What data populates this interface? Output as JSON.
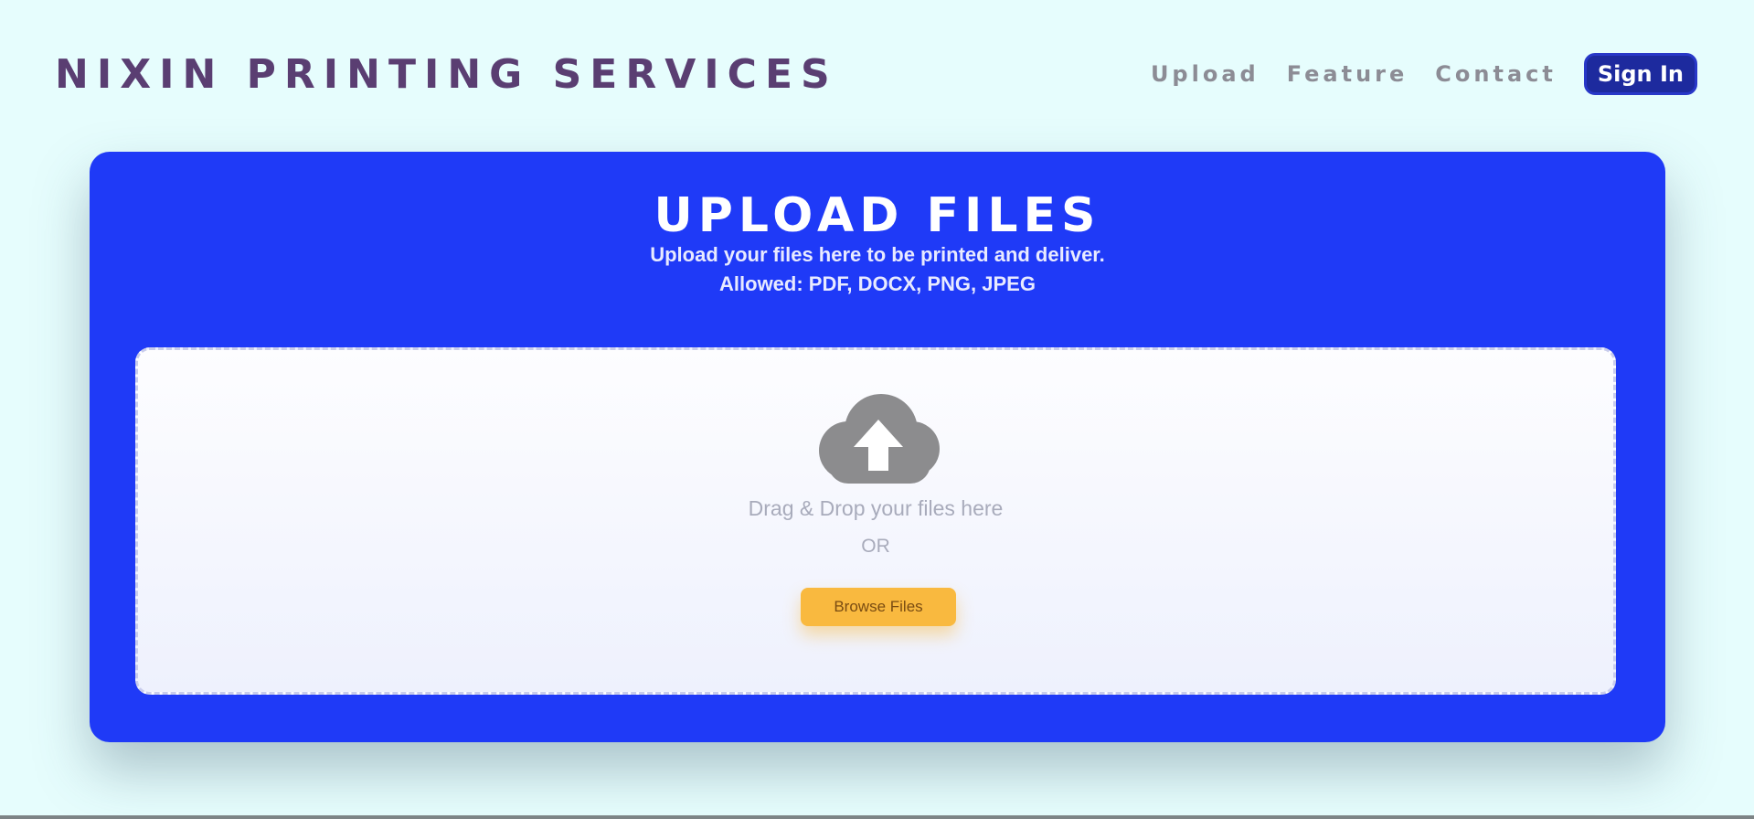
{
  "header": {
    "brand": "NIXIN PRINTING SERVICES",
    "nav": [
      "Upload",
      "Feature",
      "Contact"
    ],
    "signin_label": "Sign In"
  },
  "upload": {
    "title": "UPLOAD FILES",
    "subtitle_line1": "Upload your files here to be printed and deliver.",
    "subtitle_line2": "Allowed: PDF, DOCX, PNG, JPEG",
    "drag_text": "Drag & Drop your files here",
    "or_text": "OR",
    "browse_label": "Browse Files",
    "icon": "cloud-upload-icon"
  },
  "colors": {
    "page_bg": "#e6fdfd",
    "brand": "#5a3e72",
    "card_bg": "#1f3af7",
    "signin_bg": "#1d2a9e",
    "browse_bg": "#f9b93f",
    "icon_gray": "#8c8c8e"
  }
}
